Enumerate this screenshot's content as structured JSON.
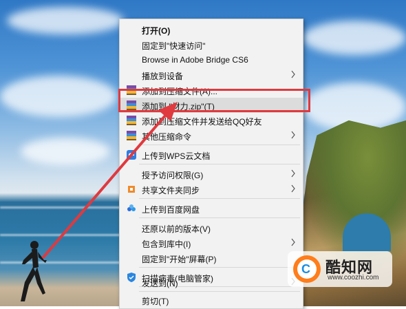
{
  "context_menu": {
    "items": [
      {
        "label": "打开(O)",
        "icon": "",
        "submenu": false,
        "bold": true
      },
      {
        "label": "固定到\"快速访问\"",
        "icon": "",
        "submenu": false
      },
      {
        "label": "Browse in Adobe Bridge CS6",
        "icon": "",
        "submenu": false
      },
      {
        "label": "播放到设备",
        "icon": "",
        "submenu": true
      },
      {
        "label": "添加到压缩文件(A)...",
        "icon": "winrar-icon",
        "submenu": false
      },
      {
        "label": "添加到 \"材力.zip\"(T)",
        "icon": "winrar-icon",
        "submenu": false,
        "highlighted": true
      },
      {
        "label": "添加到压缩文件并发送给QQ好友",
        "icon": "winrar-icon",
        "submenu": false
      },
      {
        "label": "其他压缩命令",
        "icon": "winrar-icon",
        "submenu": true
      },
      {
        "label": "上传到WPS云文档",
        "icon": "wps-cloud-icon",
        "submenu": false
      },
      {
        "label": "授予访问权限(G)",
        "icon": "",
        "submenu": true
      },
      {
        "label": "共享文件夹同步",
        "icon": "share-sync-icon",
        "submenu": true
      },
      {
        "label": "上传到百度网盘",
        "icon": "baidu-netdisk-icon",
        "submenu": false
      },
      {
        "label": "还原以前的版本(V)",
        "icon": "",
        "submenu": false
      },
      {
        "label": "包含到库中(I)",
        "icon": "",
        "submenu": true
      },
      {
        "label": "固定到\"开始\"屏幕(P)",
        "icon": "",
        "submenu": false
      },
      {
        "label": "扫描病毒(电脑管家)",
        "icon": "pc-manager-shield-icon",
        "submenu": false
      },
      {
        "label": "发送到(N)",
        "icon": "",
        "submenu": true
      },
      {
        "label": "剪切(T)",
        "icon": "",
        "submenu": false
      }
    ]
  },
  "watermark": {
    "title": "酷知网",
    "url": "www.coozhi.com",
    "logo_letter": "C"
  },
  "colors": {
    "highlight_box": "#e0393e",
    "arrow": "#e0393e",
    "menu_bg": "#f2f2f2"
  }
}
